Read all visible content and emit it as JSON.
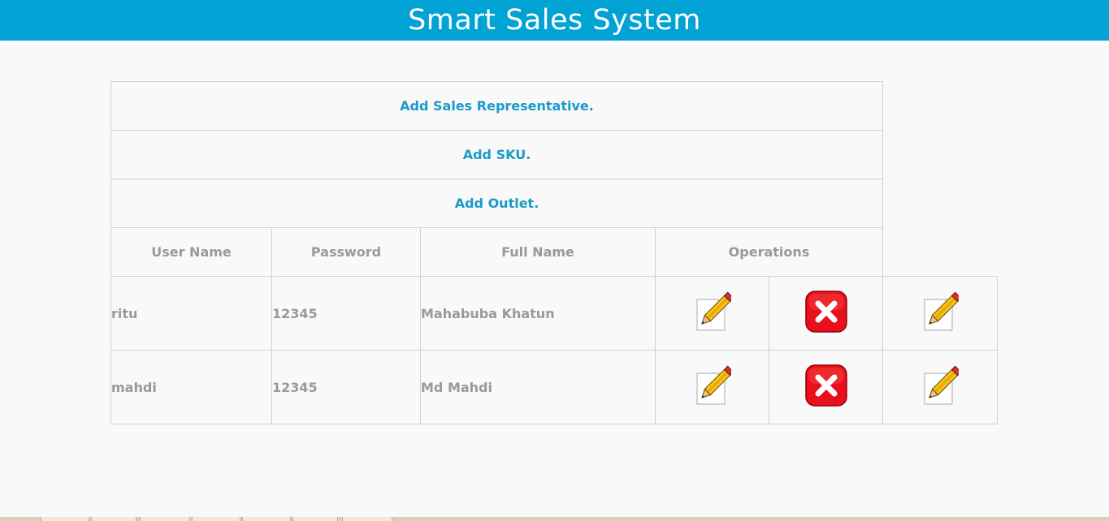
{
  "header": {
    "title": "Smart Sales System"
  },
  "links": {
    "add_sales_rep": "Add Sales Representative.",
    "add_sku": "Add SKU.",
    "add_outlet": "Add Outlet."
  },
  "table": {
    "columns": {
      "user_name": "User Name",
      "password": "Password",
      "full_name": "Full Name",
      "operations": "Operations"
    },
    "rows": [
      {
        "user_name": "ritu",
        "password": "12345",
        "full_name": "Mahabuba Khatun"
      },
      {
        "user_name": "mahdi",
        "password": "12345",
        "full_name": "Md Mahdi"
      }
    ]
  },
  "icons": {
    "edit": "pencil-edit-icon",
    "delete": "red-x-delete-icon"
  },
  "colors": {
    "header_bg": "#00a3d3",
    "link": "#1a9ac9",
    "muted_text": "#999999",
    "delete_red": "#e8101a"
  }
}
